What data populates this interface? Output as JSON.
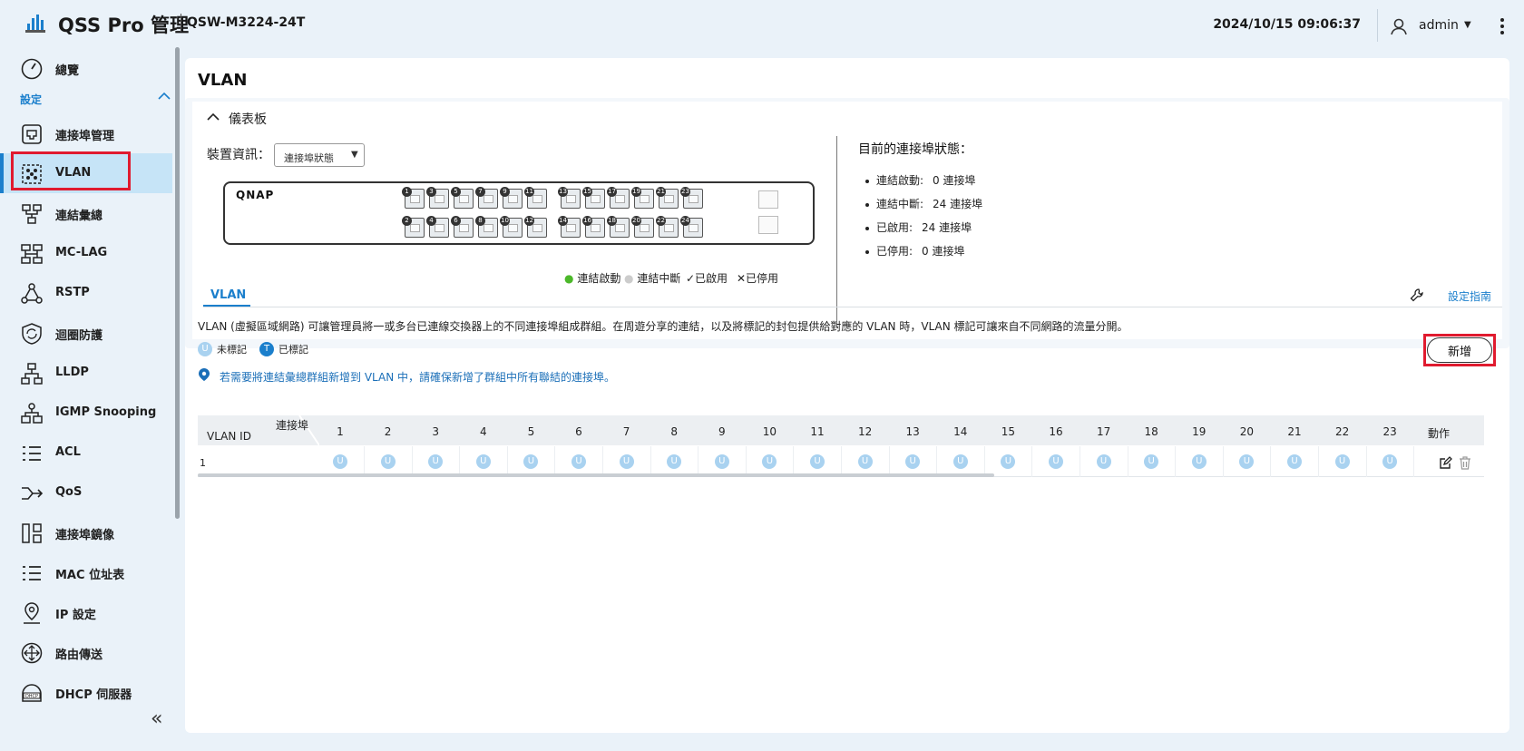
{
  "header": {
    "app_title": "QSS Pro 管理",
    "model": "QSW-M3224-24T",
    "datetime": "2024/10/15 09:06:37",
    "user": "admin"
  },
  "sidebar": {
    "overview": "總覽",
    "section": "設定",
    "items": [
      {
        "label": "連接埠管理",
        "icon": "port-icon"
      },
      {
        "label": "VLAN",
        "icon": "vlan-icon"
      },
      {
        "label": "連結彙總",
        "icon": "link-aggregation-icon"
      },
      {
        "label": "MC-LAG",
        "icon": "mclag-icon"
      },
      {
        "label": "RSTP",
        "icon": "rstp-icon"
      },
      {
        "label": "迴圈防護",
        "icon": "loop-protection-icon"
      },
      {
        "label": "LLDP",
        "icon": "lldp-icon"
      },
      {
        "label": "IGMP Snooping",
        "icon": "igmp-icon"
      },
      {
        "label": "ACL",
        "icon": "acl-icon"
      },
      {
        "label": "QoS",
        "icon": "qos-icon"
      },
      {
        "label": "連接埠鏡像",
        "icon": "port-mirror-icon"
      },
      {
        "label": "MAC 位址表",
        "icon": "mac-table-icon"
      },
      {
        "label": "IP 設定",
        "icon": "ip-settings-icon"
      },
      {
        "label": "路由傳送",
        "icon": "routing-icon"
      },
      {
        "label": "DHCP 伺服器",
        "icon": "dhcp-icon"
      }
    ],
    "active": "VLAN"
  },
  "main": {
    "title": "VLAN",
    "dashboard": {
      "title": "儀表板",
      "device_info_label": "裝置資訊：",
      "device_select_value": "連接埠狀態",
      "switch_logo": "QNAP",
      "ports_top": [
        "1",
        "3",
        "5",
        "7",
        "9",
        "11",
        "13",
        "15",
        "17",
        "19",
        "21",
        "23"
      ],
      "ports_bottom": [
        "2",
        "4",
        "6",
        "8",
        "10",
        "12",
        "14",
        "16",
        "18",
        "20",
        "22",
        "24"
      ],
      "legend": {
        "up": "連結啟動",
        "down": "連結中斷",
        "enabled": "✓已啟用",
        "disabled": "✕已停用"
      },
      "status_title": "目前的連接埠狀態：",
      "status": [
        {
          "label": "連結啟動:",
          "value": "0 連接埠"
        },
        {
          "label": "連結中斷:",
          "value": "24 連接埠"
        },
        {
          "label": "已啟用:",
          "value": "24 連接埠"
        },
        {
          "label": "已停用:",
          "value": "0 連接埠"
        }
      ]
    },
    "tab": "VLAN",
    "guide": "設定指南",
    "description": "VLAN (虛擬區域網路) 可讓管理員將一或多台已連線交換器上的不同連接埠組成群組。在周遊分享的連結，以及將標記的封包提供給對應的 VLAN 時，VLAN 標記可讓來自不同網路的流量分開。",
    "untagged_label": "未標記",
    "tagged_label": "已標記",
    "untagged_badge": "U",
    "tagged_badge": "T",
    "add_button": "新增",
    "note": "若需要將連結彙總群組新增到 VLAN 中，請確保新增了群組中所有聯結的連接埠。",
    "table": {
      "col_vlan_id": "VLAN ID",
      "col_port": "連接埠",
      "port_columns": [
        "1",
        "2",
        "3",
        "4",
        "5",
        "6",
        "7",
        "8",
        "9",
        "10",
        "11",
        "12",
        "13",
        "14",
        "15",
        "16",
        "17",
        "18",
        "19",
        "20",
        "21",
        "22",
        "23"
      ],
      "col_action": "動作",
      "rows": [
        {
          "vlan_id": "1",
          "cell": "U"
        }
      ]
    }
  }
}
